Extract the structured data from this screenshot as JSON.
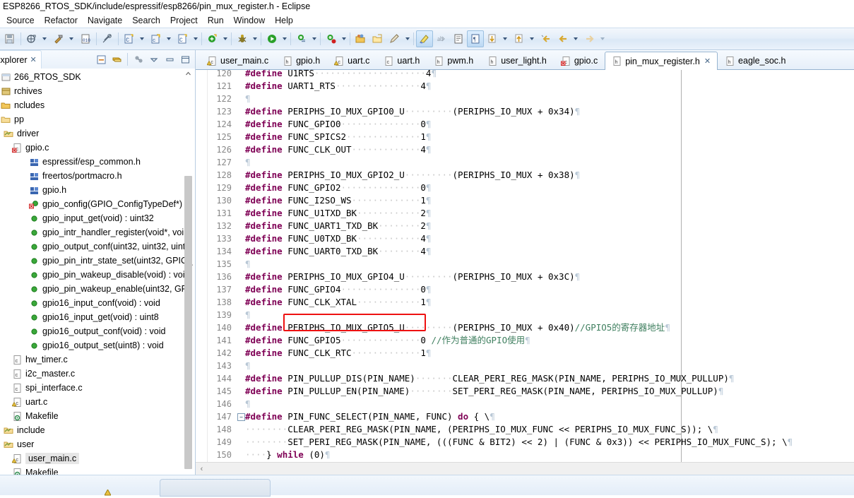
{
  "window": {
    "title": "ESP8266_RTOS_SDK/include/espressif/esp8266/pin_mux_register.h - Eclipse"
  },
  "menu": {
    "items": [
      "Source",
      "Refactor",
      "Navigate",
      "Search",
      "Project",
      "Run",
      "Window",
      "Help"
    ]
  },
  "toolbar": {
    "icons": [
      "save-all-icon",
      "new-c-class-icon",
      "build-hammer-icon",
      "binary-010-icon",
      "link-break-icon",
      "new-c-project-icon",
      "new-cpp-project-icon",
      "new-c-file-icon",
      "new-class-icon",
      "debug-bug-icon",
      "run-icon",
      "search-declaration-icon",
      "search-reference-icon",
      "open-folder-icon",
      "open-type-icon",
      "pencil-icon",
      "highlight-marker-icon",
      "spell-check-icon",
      "show-whitespace-icon",
      "toggle-block-icon",
      "next-annotation-icon",
      "previous-annotation-icon",
      "last-edit-icon",
      "back-icon",
      "forward-icon"
    ]
  },
  "explorer": {
    "tab_label": "Explorer",
    "close_glyph": "✕",
    "tools": [
      "collapse-all-icon",
      "link-with-editor-icon",
      "filter-icon",
      "view-menu-icon",
      "minimize-icon",
      "maximize-icon"
    ],
    "tree": [
      {
        "label": "266_RTOS_SDK",
        "indent": 0,
        "icon": "project-icon",
        "selected": false
      },
      {
        "label": "rchives",
        "indent": 0,
        "icon": "archive-icon",
        "selected": false
      },
      {
        "label": "ncludes",
        "indent": 0,
        "icon": "include-icon",
        "selected": false
      },
      {
        "label": "pp",
        "indent": 0,
        "icon": "folder-icon",
        "selected": false
      },
      {
        "label": "driver",
        "indent": 4,
        "icon": "src-folder-icon",
        "selected": false
      },
      {
        "label": "gpio.c",
        "indent": 16,
        "icon": "c-file-error-icon",
        "selected": false
      },
      {
        "label": "espressif/esp_common.h",
        "indent": 40,
        "icon": "header-ref-icon",
        "selected": false
      },
      {
        "label": "freertos/portmacro.h",
        "indent": 40,
        "icon": "header-ref-icon",
        "selected": false
      },
      {
        "label": "gpio.h",
        "indent": 40,
        "icon": "header-ref-icon",
        "selected": false
      },
      {
        "label": "gpio_config(GPIO_ConfigTypeDef*)",
        "indent": 40,
        "icon": "method-error-icon",
        "selected": false
      },
      {
        "label": "gpio_input_get(void) : uint32",
        "indent": 40,
        "icon": "method-icon",
        "selected": false
      },
      {
        "label": "gpio_intr_handler_register(void*, voi",
        "indent": 40,
        "icon": "method-icon",
        "selected": false
      },
      {
        "label": "gpio_output_conf(uint32, uint32, uint",
        "indent": 40,
        "icon": "method-icon",
        "selected": false
      },
      {
        "label": "gpio_pin_intr_state_set(uint32, GPIO_",
        "indent": 40,
        "icon": "method-icon",
        "selected": false
      },
      {
        "label": "gpio_pin_wakeup_disable(void) : voi",
        "indent": 40,
        "icon": "method-icon",
        "selected": false
      },
      {
        "label": "gpio_pin_wakeup_enable(uint32, GP",
        "indent": 40,
        "icon": "method-icon",
        "selected": false
      },
      {
        "label": "gpio16_input_conf(void) : void",
        "indent": 40,
        "icon": "method-icon",
        "selected": false
      },
      {
        "label": "gpio16_input_get(void) : uint8",
        "indent": 40,
        "icon": "method-icon",
        "selected": false
      },
      {
        "label": "gpio16_output_conf(void) : void",
        "indent": 40,
        "icon": "method-icon",
        "selected": false
      },
      {
        "label": "gpio16_output_set(uint8) : void",
        "indent": 40,
        "icon": "method-icon",
        "selected": false
      },
      {
        "label": "hw_timer.c",
        "indent": 16,
        "icon": "c-file-icon",
        "selected": false
      },
      {
        "label": "i2c_master.c",
        "indent": 16,
        "icon": "c-file-icon",
        "selected": false
      },
      {
        "label": "spi_interface.c",
        "indent": 16,
        "icon": "c-file-icon",
        "selected": false
      },
      {
        "label": "uart.c",
        "indent": 16,
        "icon": "c-file-warn-icon",
        "selected": false
      },
      {
        "label": "Makefile",
        "indent": 16,
        "icon": "makefile-icon",
        "selected": false
      },
      {
        "label": "include",
        "indent": 4,
        "icon": "src-folder-icon",
        "selected": false
      },
      {
        "label": "user",
        "indent": 4,
        "icon": "src-folder-icon",
        "selected": false
      },
      {
        "label": "user_main.c",
        "indent": 16,
        "icon": "c-file-warn-icon",
        "selected": true
      },
      {
        "label": "Makefile",
        "indent": 16,
        "icon": "makefile-icon",
        "selected": false
      }
    ]
  },
  "editor": {
    "tabs": [
      {
        "label": "user_main.c",
        "icon": "c-file-warn-icon",
        "active": false
      },
      {
        "label": "gpio.h",
        "icon": "header-file-icon",
        "active": false
      },
      {
        "label": "uart.c",
        "icon": "c-file-warn-icon",
        "active": false
      },
      {
        "label": "uart.h",
        "icon": "c-file-icon",
        "active": false
      },
      {
        "label": "pwm.h",
        "icon": "header-file-icon",
        "active": false
      },
      {
        "label": "user_light.h",
        "icon": "header-file-icon",
        "active": false
      },
      {
        "label": "gpio.c",
        "icon": "c-file-error-icon",
        "active": false
      },
      {
        "label": "pin_mux_register.h",
        "icon": "header-file-icon",
        "active": true,
        "close_glyph": "✕"
      },
      {
        "label": "eagle_soc.h",
        "icon": "header-file-icon",
        "active": false
      }
    ],
    "lines": [
      {
        "n": "120",
        "fold": "",
        "partial": true,
        "segs": [
          {
            "t": "#define ",
            "c": "pre"
          },
          {
            "t": "U1RTS",
            "c": "id"
          },
          {
            "t": "·····················",
            "c": "dots"
          },
          {
            "t": "4",
            "c": "num"
          },
          {
            "t": "¶",
            "c": "pil"
          }
        ]
      },
      {
        "n": "121",
        "fold": "",
        "segs": [
          {
            "t": "#define ",
            "c": "pre"
          },
          {
            "t": "UART1_RTS",
            "c": "id"
          },
          {
            "t": "················",
            "c": "dots"
          },
          {
            "t": "4",
            "c": "num"
          },
          {
            "t": "¶",
            "c": "pil"
          }
        ]
      },
      {
        "n": "122",
        "fold": "",
        "segs": [
          {
            "t": "¶",
            "c": "pil"
          }
        ]
      },
      {
        "n": "123",
        "fold": "",
        "segs": [
          {
            "t": "#define ",
            "c": "pre"
          },
          {
            "t": "PERIPHS_IO_MUX_GPIO0_U",
            "c": "id"
          },
          {
            "t": "·········",
            "c": "dots"
          },
          {
            "t": "(PERIPHS_IO_MUX + 0x34)",
            "c": "id"
          },
          {
            "t": "¶",
            "c": "pil"
          }
        ]
      },
      {
        "n": "124",
        "fold": "",
        "segs": [
          {
            "t": "#define ",
            "c": "pre"
          },
          {
            "t": "FUNC_GPIO0",
            "c": "id"
          },
          {
            "t": "···············",
            "c": "dots"
          },
          {
            "t": "0",
            "c": "num"
          },
          {
            "t": "¶",
            "c": "pil"
          }
        ]
      },
      {
        "n": "125",
        "fold": "",
        "segs": [
          {
            "t": "#define ",
            "c": "pre"
          },
          {
            "t": "FUNC_SPICS2",
            "c": "id"
          },
          {
            "t": "··············",
            "c": "dots"
          },
          {
            "t": "1",
            "c": "num"
          },
          {
            "t": "¶",
            "c": "pil"
          }
        ]
      },
      {
        "n": "126",
        "fold": "",
        "segs": [
          {
            "t": "#define ",
            "c": "pre"
          },
          {
            "t": "FUNC_CLK_OUT",
            "c": "id"
          },
          {
            "t": "·············",
            "c": "dots"
          },
          {
            "t": "4",
            "c": "num"
          },
          {
            "t": "¶",
            "c": "pil"
          }
        ]
      },
      {
        "n": "127",
        "fold": "",
        "segs": [
          {
            "t": "¶",
            "c": "pil"
          }
        ]
      },
      {
        "n": "128",
        "fold": "",
        "segs": [
          {
            "t": "#define ",
            "c": "pre"
          },
          {
            "t": "PERIPHS_IO_MUX_GPIO2_U",
            "c": "id"
          },
          {
            "t": "·········",
            "c": "dots"
          },
          {
            "t": "(PERIPHS_IO_MUX + 0x38)",
            "c": "id"
          },
          {
            "t": "¶",
            "c": "pil"
          }
        ]
      },
      {
        "n": "129",
        "fold": "",
        "segs": [
          {
            "t": "#define ",
            "c": "pre"
          },
          {
            "t": "FUNC_GPIO2",
            "c": "id"
          },
          {
            "t": "···············",
            "c": "dots"
          },
          {
            "t": "0",
            "c": "num"
          },
          {
            "t": "¶",
            "c": "pil"
          }
        ]
      },
      {
        "n": "130",
        "fold": "",
        "segs": [
          {
            "t": "#define ",
            "c": "pre"
          },
          {
            "t": "FUNC_I2SO_WS",
            "c": "id"
          },
          {
            "t": "·············",
            "c": "dots"
          },
          {
            "t": "1",
            "c": "num"
          },
          {
            "t": "¶",
            "c": "pil"
          }
        ]
      },
      {
        "n": "131",
        "fold": "",
        "segs": [
          {
            "t": "#define ",
            "c": "pre"
          },
          {
            "t": "FUNC_U1TXD_BK",
            "c": "id"
          },
          {
            "t": "············",
            "c": "dots"
          },
          {
            "t": "2",
            "c": "num"
          },
          {
            "t": "¶",
            "c": "pil"
          }
        ]
      },
      {
        "n": "132",
        "fold": "",
        "segs": [
          {
            "t": "#define ",
            "c": "pre"
          },
          {
            "t": "FUNC_UART1_TXD_BK",
            "c": "id"
          },
          {
            "t": "········",
            "c": "dots"
          },
          {
            "t": "2",
            "c": "num"
          },
          {
            "t": "¶",
            "c": "pil"
          }
        ]
      },
      {
        "n": "133",
        "fold": "",
        "segs": [
          {
            "t": "#define ",
            "c": "pre"
          },
          {
            "t": "FUNC_U0TXD_BK",
            "c": "id"
          },
          {
            "t": "············",
            "c": "dots"
          },
          {
            "t": "4",
            "c": "num"
          },
          {
            "t": "¶",
            "c": "pil"
          }
        ]
      },
      {
        "n": "134",
        "fold": "",
        "segs": [
          {
            "t": "#define ",
            "c": "pre"
          },
          {
            "t": "FUNC_UART0_TXD_BK",
            "c": "id"
          },
          {
            "t": "········",
            "c": "dots"
          },
          {
            "t": "4",
            "c": "num"
          },
          {
            "t": "¶",
            "c": "pil"
          }
        ]
      },
      {
        "n": "135",
        "fold": "",
        "segs": [
          {
            "t": "¶",
            "c": "pil"
          }
        ]
      },
      {
        "n": "136",
        "fold": "",
        "segs": [
          {
            "t": "#define ",
            "c": "pre"
          },
          {
            "t": "PERIPHS_IO_MUX_GPIO4_U",
            "c": "id"
          },
          {
            "t": "·········",
            "c": "dots"
          },
          {
            "t": "(PERIPHS_IO_MUX + 0x3C)",
            "c": "id"
          },
          {
            "t": "¶",
            "c": "pil"
          }
        ]
      },
      {
        "n": "137",
        "fold": "",
        "segs": [
          {
            "t": "#define ",
            "c": "pre"
          },
          {
            "t": "FUNC_GPIO4",
            "c": "id"
          },
          {
            "t": "···············",
            "c": "dots"
          },
          {
            "t": "0",
            "c": "num"
          },
          {
            "t": "¶",
            "c": "pil"
          }
        ]
      },
      {
        "n": "138",
        "fold": "",
        "segs": [
          {
            "t": "#define ",
            "c": "pre"
          },
          {
            "t": "FUNC_CLK_XTAL",
            "c": "id"
          },
          {
            "t": "············",
            "c": "dots"
          },
          {
            "t": "1",
            "c": "num"
          },
          {
            "t": "¶",
            "c": "pil"
          }
        ]
      },
      {
        "n": "139",
        "fold": "",
        "segs": [
          {
            "t": "¶",
            "c": "pil"
          }
        ]
      },
      {
        "n": "140",
        "fold": "",
        "highlight": true,
        "segs": [
          {
            "t": "#define ",
            "c": "pre"
          },
          {
            "t": "PERIPHS_IO_MUX_GPIO5_U",
            "c": "id"
          },
          {
            "t": "·········",
            "c": "dots"
          },
          {
            "t": "(PERIPHS_IO_MUX + 0x40)",
            "c": "id"
          },
          {
            "t": "//GPIO5的寄存器地址",
            "c": "cmt"
          },
          {
            "t": "¶",
            "c": "pil"
          }
        ]
      },
      {
        "n": "141",
        "fold": "",
        "segs": [
          {
            "t": "#define ",
            "c": "pre"
          },
          {
            "t": "FUNC_GPIO5",
            "c": "id"
          },
          {
            "t": "···············",
            "c": "dots"
          },
          {
            "t": "0 ",
            "c": "num"
          },
          {
            "t": "//作为普通的GPIO使用",
            "c": "cmt"
          },
          {
            "t": "¶",
            "c": "pil"
          }
        ]
      },
      {
        "n": "142",
        "fold": "",
        "segs": [
          {
            "t": "#define ",
            "c": "pre"
          },
          {
            "t": "FUNC_CLK_RTC",
            "c": "id"
          },
          {
            "t": "·············",
            "c": "dots"
          },
          {
            "t": "1",
            "c": "num"
          },
          {
            "t": "¶",
            "c": "pil"
          }
        ]
      },
      {
        "n": "143",
        "fold": "",
        "segs": [
          {
            "t": "¶",
            "c": "pil"
          }
        ]
      },
      {
        "n": "144",
        "fold": "",
        "segs": [
          {
            "t": "#define ",
            "c": "pre"
          },
          {
            "t": "PIN_PULLUP_DIS(PIN_NAME)",
            "c": "id"
          },
          {
            "t": "·······",
            "c": "dots"
          },
          {
            "t": "CLEAR_PERI_REG_MASK(PIN_NAME, PERIPHS_IO_MUX_PULLUP)",
            "c": "id"
          },
          {
            "t": "¶",
            "c": "pil"
          }
        ]
      },
      {
        "n": "145",
        "fold": "",
        "segs": [
          {
            "t": "#define ",
            "c": "pre"
          },
          {
            "t": "PIN_PULLUP_EN(PIN_NAME)",
            "c": "id"
          },
          {
            "t": "········",
            "c": "dots"
          },
          {
            "t": "SET_PERI_REG_MASK(PIN_NAME, PERIPHS_IO_MUX_PULLUP)",
            "c": "id"
          },
          {
            "t": "¶",
            "c": "pil"
          }
        ]
      },
      {
        "n": "146",
        "fold": "",
        "segs": [
          {
            "t": "¶",
            "c": "pil"
          }
        ]
      },
      {
        "n": "147",
        "fold": "minus",
        "segs": [
          {
            "t": "#define ",
            "c": "pre"
          },
          {
            "t": "PIN_FUNC_SELECT(PIN_NAME, FUNC) ",
            "c": "id"
          },
          {
            "t": "do",
            "c": "ctrl"
          },
          {
            "t": " { \\",
            "c": "id"
          },
          {
            "t": "¶",
            "c": "pil"
          }
        ]
      },
      {
        "n": "148",
        "fold": "",
        "segs": [
          {
            "t": "········",
            "c": "dots"
          },
          {
            "t": "CLEAR_PERI_REG_MASK(PIN_NAME, (PERIPHS_IO_MUX_FUNC << PERIPHS_IO_MUX_FUNC_S)); \\",
            "c": "id"
          },
          {
            "t": "¶",
            "c": "pil"
          }
        ]
      },
      {
        "n": "149",
        "fold": "",
        "segs": [
          {
            "t": "········",
            "c": "dots"
          },
          {
            "t": "SET_PERI_REG_MASK(PIN_NAME, (((FUNC & BIT2) << 2) | (FUNC & 0x3)) << PERIPHS_IO_MUX_FUNC_S); \\",
            "c": "id"
          },
          {
            "t": "¶",
            "c": "pil"
          }
        ]
      },
      {
        "n": "150",
        "fold": "",
        "segs": [
          {
            "t": "····",
            "c": "dots"
          },
          {
            "t": "} ",
            "c": "id"
          },
          {
            "t": "while",
            "c": "ctrl"
          },
          {
            "t": " (0)",
            "c": "id"
          },
          {
            "t": "¶",
            "c": "pil"
          }
        ]
      }
    ],
    "annotation": {
      "kind": "red-rectangle-highlight",
      "color": "#ee1111",
      "target": "PERIPHS_IO_MUX_GPIO5_U"
    },
    "scroll_left_glyph": "‹"
  },
  "colors": {
    "preprocessor": "#7f0055",
    "comment": "#3f7f5f",
    "highlight_box": "#ee1111",
    "chrome": "#dbe8f6",
    "selection": "#e6e6e6"
  }
}
